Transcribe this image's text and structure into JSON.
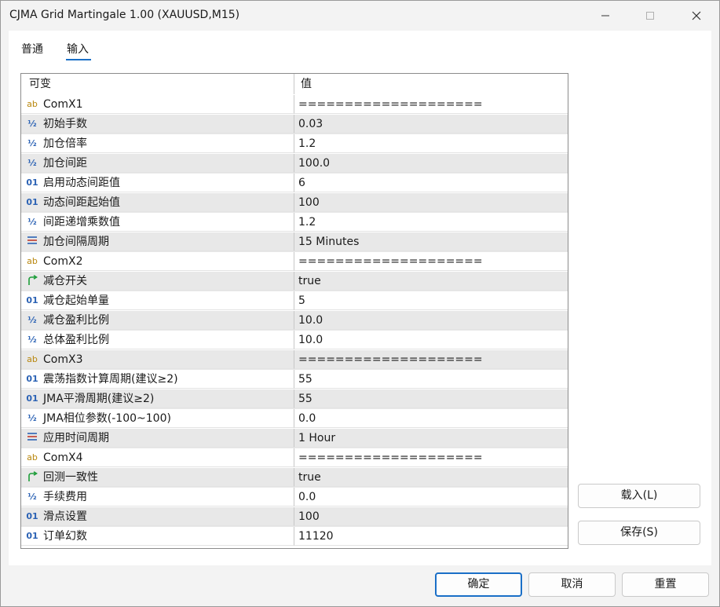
{
  "window": {
    "title": "CJMA Grid Martingale 1.00 (XAUUSD,M15)"
  },
  "tabs": [
    {
      "label": "普通",
      "active": false
    },
    {
      "label": "输入",
      "active": true
    }
  ],
  "grid": {
    "header": {
      "name": "可变",
      "value": "值"
    },
    "rows": [
      {
        "icon": "ab",
        "name": "ComX1",
        "value": "===================="
      },
      {
        "icon": "half",
        "name": "初始手数",
        "value": "0.03"
      },
      {
        "icon": "half",
        "name": "加仓倍率",
        "value": "1.2"
      },
      {
        "icon": "half",
        "name": "加仓间距",
        "value": "100.0"
      },
      {
        "icon": "01",
        "name": "启用动态间距值",
        "value": "6"
      },
      {
        "icon": "01",
        "name": "动态间距起始值",
        "value": "100"
      },
      {
        "icon": "half",
        "name": "间距递增乘数值",
        "value": "1.2"
      },
      {
        "icon": "enum",
        "name": "加仓间隔周期",
        "value": "15 Minutes"
      },
      {
        "icon": "ab",
        "name": "ComX2",
        "value": "===================="
      },
      {
        "icon": "bool",
        "name": "减仓开关",
        "value": "true"
      },
      {
        "icon": "01",
        "name": "减仓起始单量",
        "value": "5"
      },
      {
        "icon": "half",
        "name": "减仓盈利比例",
        "value": "10.0"
      },
      {
        "icon": "half",
        "name": "总体盈利比例",
        "value": "10.0"
      },
      {
        "icon": "ab",
        "name": "ComX3",
        "value": "===================="
      },
      {
        "icon": "01",
        "name": "震荡指数计算周期(建议≥2)",
        "value": "55"
      },
      {
        "icon": "01",
        "name": "JMA平滑周期(建议≥2)",
        "value": "55"
      },
      {
        "icon": "half",
        "name": "JMA相位参数(-100~100)",
        "value": "0.0"
      },
      {
        "icon": "enum",
        "name": "应用时间周期",
        "value": "1 Hour"
      },
      {
        "icon": "ab",
        "name": "ComX4",
        "value": "===================="
      },
      {
        "icon": "bool",
        "name": "回测一致性",
        "value": "true"
      },
      {
        "icon": "half",
        "name": "手续费用",
        "value": "0.0"
      },
      {
        "icon": "01",
        "name": "滑点设置",
        "value": "100"
      },
      {
        "icon": "01",
        "name": "订单幻数",
        "value": "11120"
      }
    ]
  },
  "icon_glyphs": {
    "ab": "ab",
    "half": "½",
    "01": "01"
  },
  "buttons": {
    "load": "载入(L)",
    "save": "保存(S)",
    "ok": "确定",
    "cancel": "取消",
    "reset": "重置"
  },
  "colors": {
    "accent": "#1a6fc7",
    "alt_row": "#e8e8e8",
    "icon_ab": "#b8860b",
    "icon_num": "#2b62b4",
    "icon_bool": "#1e9e3a",
    "icon_enum": "#c0392b"
  }
}
